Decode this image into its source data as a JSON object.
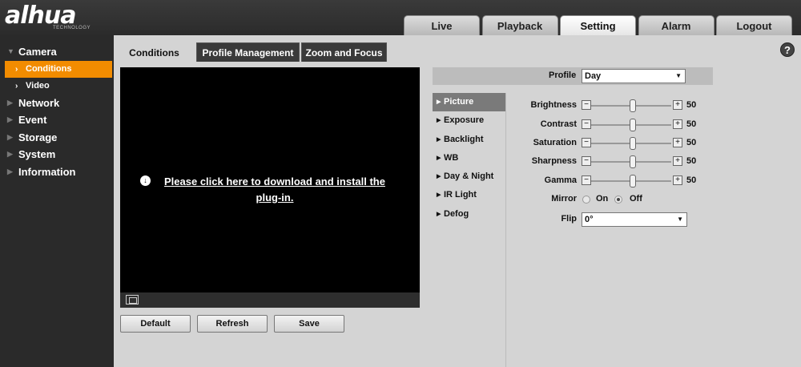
{
  "brand": {
    "logo": "alhua",
    "sub": "TECHNOLOGY"
  },
  "topnav": [
    "Live",
    "Playback",
    "Setting",
    "Alarm",
    "Logout"
  ],
  "sidebar": {
    "camera": "Camera",
    "conditions": "Conditions",
    "video": "Video",
    "network": "Network",
    "event": "Event",
    "storage": "Storage",
    "system": "System",
    "information": "Information"
  },
  "subtabs": [
    "Conditions",
    "Profile Management",
    "Zoom and Focus"
  ],
  "help": "?",
  "video": {
    "plugin_line1": "Please click here to download and install the",
    "plugin_line2": "plug-in."
  },
  "buttons": {
    "default": "Default",
    "refresh": "Refresh",
    "save": "Save"
  },
  "profile": {
    "label": "Profile",
    "value": "Day"
  },
  "vtabs": [
    "Picture",
    "Exposure",
    "Backlight",
    "WB",
    "Day & Night",
    "IR Light",
    "Defog"
  ],
  "sliders": [
    {
      "label": "Brightness",
      "value": "50"
    },
    {
      "label": "Contrast",
      "value": "50"
    },
    {
      "label": "Saturation",
      "value": "50"
    },
    {
      "label": "Sharpness",
      "value": "50"
    },
    {
      "label": "Gamma",
      "value": "50"
    }
  ],
  "mirror": {
    "label": "Mirror",
    "on": "On",
    "off": "Off",
    "selected": "Off"
  },
  "flip": {
    "label": "Flip",
    "value": "0°"
  }
}
